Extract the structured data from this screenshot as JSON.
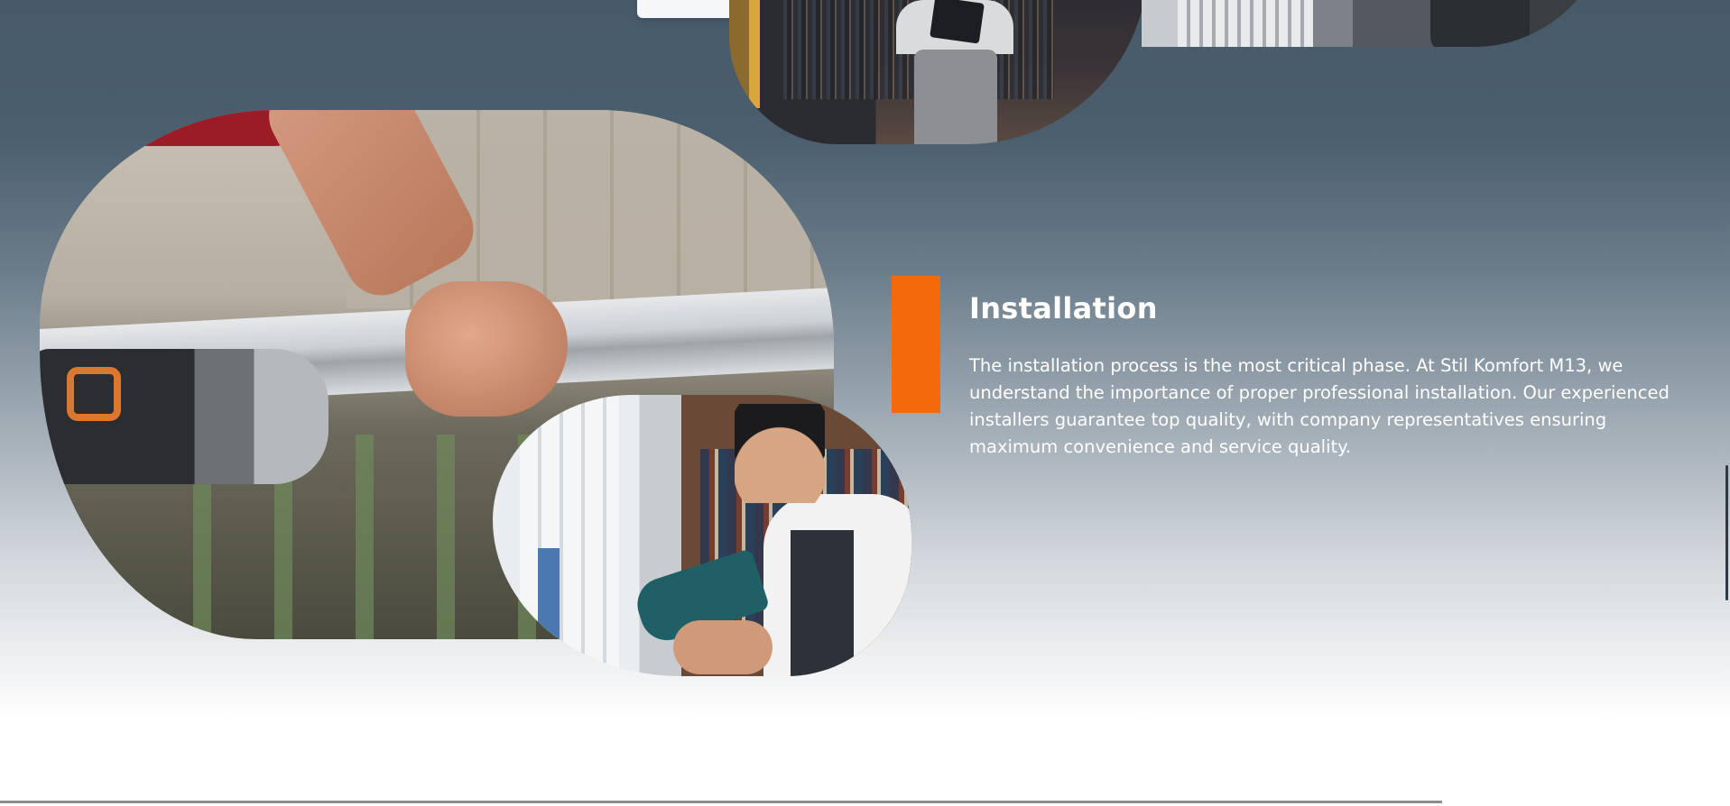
{
  "section": {
    "title": "Installation",
    "description": "The installation process is the most critical phase. At Stil Komfort M13, we understand the importance of proper professional installation. Our experienced installers guarantee top quality, with company representatives ensuring maximum convenience and service quality."
  },
  "colors": {
    "accent": "#f26a0b",
    "background_top": "#475a6a",
    "background_bottom": "#ffffff",
    "text": "#ffffff"
  },
  "images": {
    "top_center": "worker-with-tablet-photo",
    "top_right": "worker-with-window-frames-photo",
    "main": "drilling-aluminium-profile-photo",
    "secondary": "young-worker-with-drill-photo"
  }
}
